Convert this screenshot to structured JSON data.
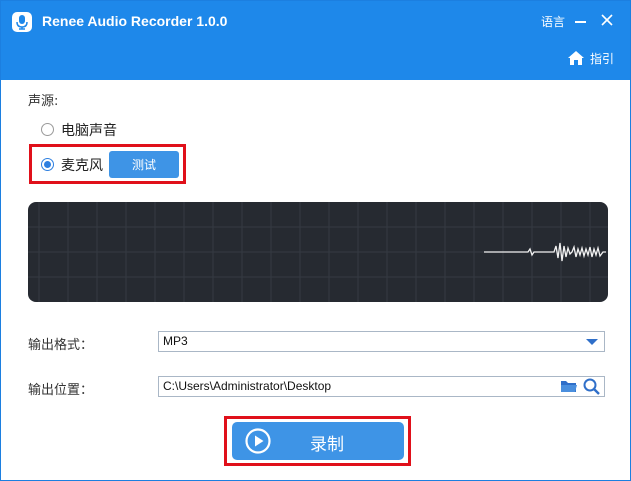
{
  "app": {
    "title": "Renee Audio Recorder 1.0.0",
    "icon": "microphone-icon"
  },
  "titlebar": {
    "language_label": "语言",
    "guide_label": "指引",
    "guide_icon": "home-icon",
    "minimize_icon": "minimize-icon",
    "close_icon": "close-icon",
    "background_color": "#1e88ea"
  },
  "source": {
    "label": "声源:",
    "options": [
      {
        "label": "电脑声音",
        "checked": false
      },
      {
        "label": "麦克风",
        "checked": true
      }
    ],
    "test_button": "测试"
  },
  "output": {
    "format_label": "输出格式：",
    "format_value": "MP3",
    "location_label": "输出位置：",
    "location_value": "C:\\Users\\Administrator\\Desktop",
    "folder_icon": "folder-icon",
    "search_icon": "search-icon"
  },
  "record": {
    "label": "录制",
    "icon": "play-icon"
  },
  "colors": {
    "accent": "#3e94e6",
    "highlight": "#e0101a",
    "waveform_bg": "#262a31"
  }
}
